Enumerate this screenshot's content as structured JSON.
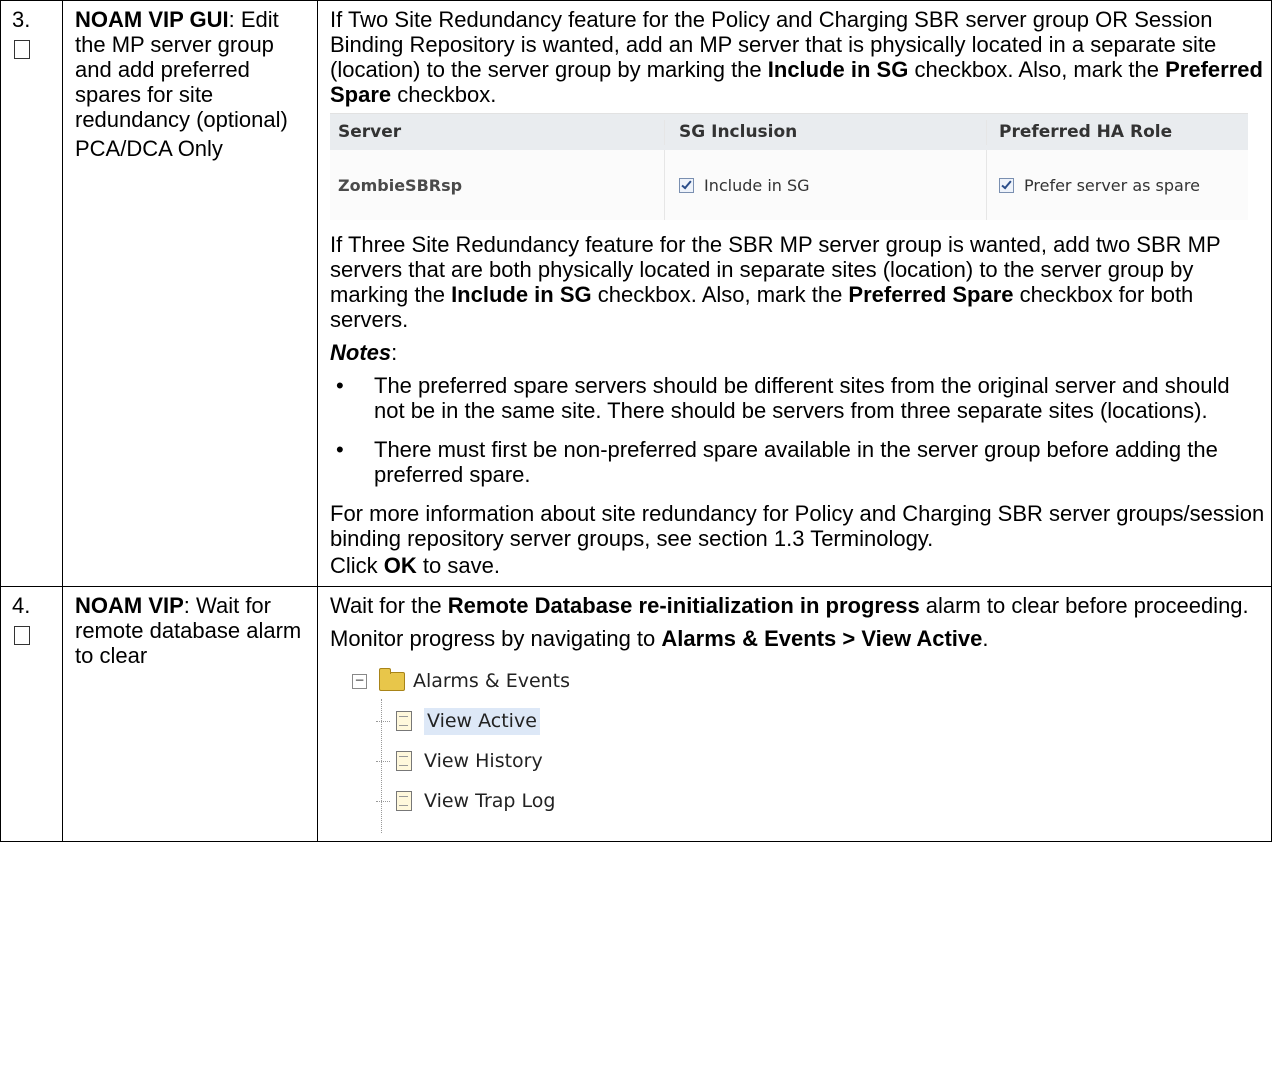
{
  "row3": {
    "step": "3.",
    "left_bold": "NOAM VIP GUI",
    "left_rest": ": Edit the MP server group and add preferred spares for site redundancy (optional)",
    "left_extra": "PCA/DCA Only",
    "para1": {
      "a": "If Two Site Redundancy feature for the Policy and Charging SBR server group OR Session Binding Repository is wanted, add an MP server that is physically located in a separate site (location) to the server group by marking the ",
      "b": "Include in SG",
      "c": " checkbox.  Also, mark the ",
      "d": "Preferred Spare",
      "e": " checkbox."
    },
    "sg_table": {
      "headers": [
        "Server",
        "SG Inclusion",
        "Preferred HA Role"
      ],
      "server": "ZombieSBRsp",
      "inclusion": "Include in SG",
      "role": "Prefer server as spare"
    },
    "para2": {
      "a": "If Three Site Redundancy feature for the SBR MP server group is wanted, add two SBR MP servers that are both physically located in separate sites (location) to the server group by marking the ",
      "b": "Include in SG",
      "c": " checkbox.  Also, mark the ",
      "d": "Preferred Spare",
      "e": " checkbox for both servers."
    },
    "notes_title": "Notes",
    "notes": [
      "The preferred spare servers should be different sites from the original server and should not be in the same site.  There should be servers from three separate sites (locations).",
      "There must first be non-preferred spare available in the server group before adding the preferred spare."
    ],
    "para3": "For more information about site redundancy for Policy and Charging SBR server groups/session binding repository server groups, see section 1.3 Terminology.",
    "click_a": "Click ",
    "click_b": "OK",
    "click_c": " to save."
  },
  "row4": {
    "step": "4.",
    "left_bold": "NOAM VIP",
    "left_rest": ":  Wait for remote database alarm to clear",
    "wait_a": "Wait for the ",
    "wait_b": "Remote Database re-initialization in progress",
    "wait_c": " alarm to clear before proceeding.",
    "monitor_a": "Monitor progress by navigating to ",
    "monitor_b": "Alarms & Events > View Active",
    "monitor_c": ".",
    "tree": {
      "root": "Alarms & Events",
      "items": [
        "View Active",
        "View History",
        "View Trap Log"
      ]
    }
  }
}
